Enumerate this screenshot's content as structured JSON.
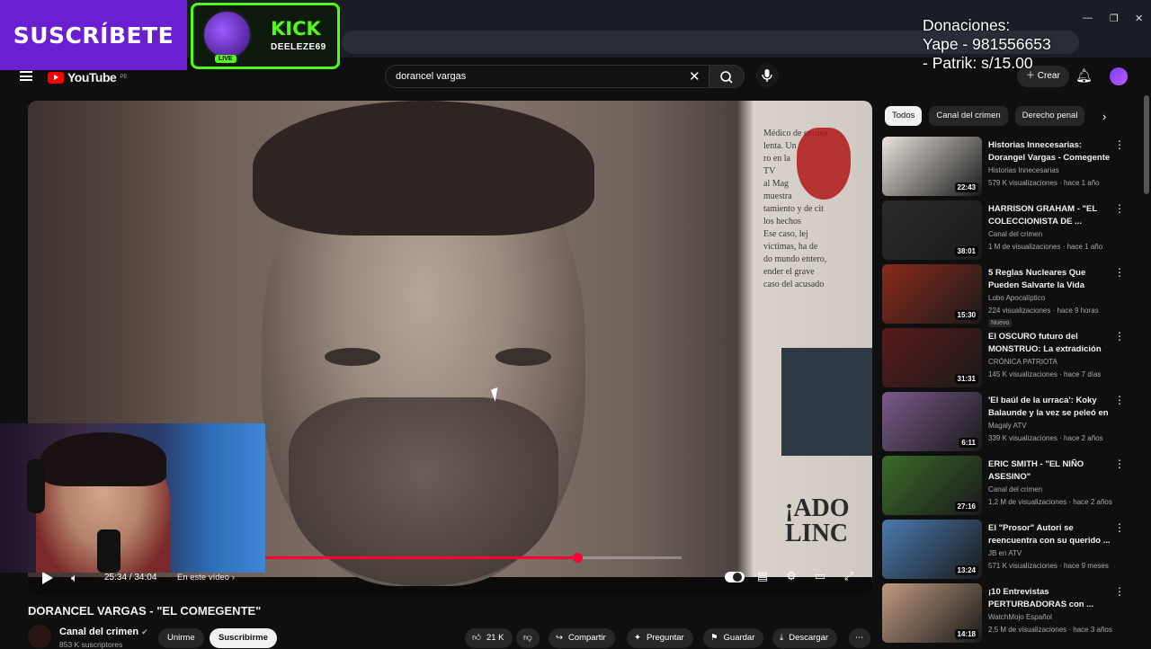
{
  "overlay": {
    "subscribe": "SUSCRÍBETE",
    "kick_title": "KICK",
    "kick_user": "DEELEZE69",
    "kick_live": "LIVE",
    "donation_lines": [
      "Donaciones:",
      "Yape - 981556653",
      "- Patrik: s/15.00"
    ]
  },
  "header": {
    "logo": "YouTube",
    "logo_region": "PE",
    "search_value": "dorancel    vargas",
    "create_label": "Crear"
  },
  "player": {
    "time": "25:34 / 34:04",
    "chapter": "En este vídeo",
    "progress": 0.75,
    "frame_text": [
      "Médico de cornea",
      "lenta. Un",
      "ro en la",
      "TV",
      "al Mag",
      "muestra",
      "tamiento y de cit",
      "los hechos",
      "Ese caso, lej",
      "víctimas, ha de",
      "do mundo entero,",
      "ender el grave",
      "caso del acusado"
    ],
    "frame_headline": [
      "¡ADO",
      "LINC"
    ]
  },
  "video": {
    "title": "DORANCEL VARGAS - \"EL COMEGENTE\"",
    "channel": "Canal del crimen",
    "subscribers": "853 K suscriptores",
    "join_label": "Unirme",
    "subscribe_label": "Suscribirme",
    "likes": "21 K",
    "share_label": "Compartir",
    "ask_label": "Preguntar",
    "save_label": "Guardar",
    "download_label": "Descargar"
  },
  "chips": [
    "Todos",
    "Canal del crimen",
    "Derecho penal"
  ],
  "recommendations": [
    {
      "title": "Historias Innecesarias: Dorangel Vargas - Comegente",
      "channel": "Historias Innecesarias",
      "meta": "579 K visualizaciones · hace 1 año",
      "duration": "22:43",
      "color": "#e8e3dc",
      "badge": ""
    },
    {
      "title": "HARRISON GRAHAM - \"EL COLECCIONISTA DE ...",
      "channel": "Canal del crimen",
      "meta": "1 M de visualizaciones · hace 1 año",
      "duration": "38:01",
      "color": "#2b2b2b",
      "badge": ""
    },
    {
      "title": "5 Reglas Nucleares Que Pueden Salvarte la Vida",
      "channel": "Lobo Apocalíptico",
      "meta": "224 visualizaciones · hace 9 horas",
      "duration": "15:30",
      "color": "#8a2a1a",
      "badge": "Nuevo"
    },
    {
      "title": "El OSCURO futuro del MONSTRUO: La extradición q...",
      "channel": "CRÓNICA PATRIOTA",
      "meta": "145 K visualizaciones · hace 7 días",
      "duration": "31:31",
      "color": "#5a1a1a",
      "badge": ""
    },
    {
      "title": "'El baúl de la urraca': Koky Balaunde y la vez se peleó en ...",
      "channel": "Magaly ATV",
      "meta": "339 K visualizaciones · hace 2 años",
      "duration": "6:11",
      "color": "#7a5a8a",
      "badge": ""
    },
    {
      "title": "ERIC SMITH - \"EL NIÑO ASESINO\"",
      "channel": "Canal del crimen",
      "meta": "1,2 M de visualizaciones · hace 2 años",
      "duration": "27:16",
      "color": "#3a6a2a",
      "badge": ""
    },
    {
      "title": "El \"Prosor\" Autori se reencuentra con su querido ...",
      "channel": "JB en ATV",
      "meta": "571 K visualizaciones · hace 9 meses",
      "duration": "13:24",
      "color": "#4a7ab0",
      "badge": ""
    },
    {
      "title": "¡10 Entrevistas PERTURBADORAS con ...",
      "channel": "WatchMojo Español",
      "meta": "2,5 M de visualizaciones · hace 3 años",
      "duration": "14:18",
      "color": "#c09a80",
      "badge": ""
    }
  ]
}
